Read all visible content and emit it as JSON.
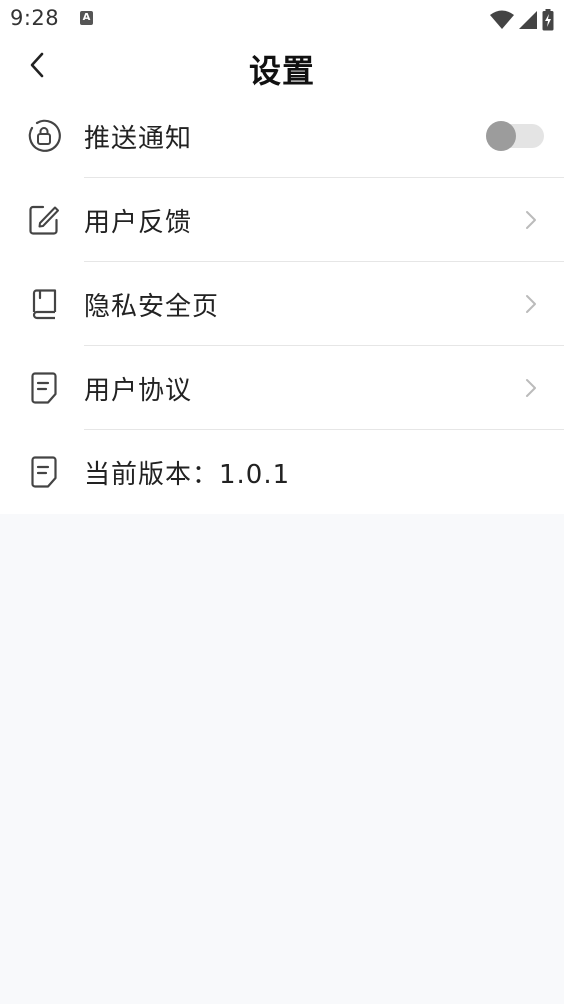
{
  "status_bar": {
    "time": "9:28",
    "notification_letter": "A"
  },
  "header": {
    "title": "设置"
  },
  "settings": {
    "push": {
      "label": "推送通知",
      "enabled": false
    },
    "feedback": {
      "label": "用户反馈"
    },
    "privacy": {
      "label": "隐私安全页"
    },
    "agreement": {
      "label": "用户协议"
    },
    "version": {
      "label": "当前版本：1.0.1"
    }
  },
  "colors": {
    "background": "#f8f9fb",
    "surface": "#ffffff",
    "toggle_track": "#e4e4e4",
    "toggle_knob": "#9c9c9c",
    "divider": "#e6e6e6"
  },
  "icons": {
    "push": "lock-circle-icon",
    "feedback": "edit-icon",
    "privacy": "book-icon",
    "agreement": "document-icon",
    "version": "document-icon"
  }
}
